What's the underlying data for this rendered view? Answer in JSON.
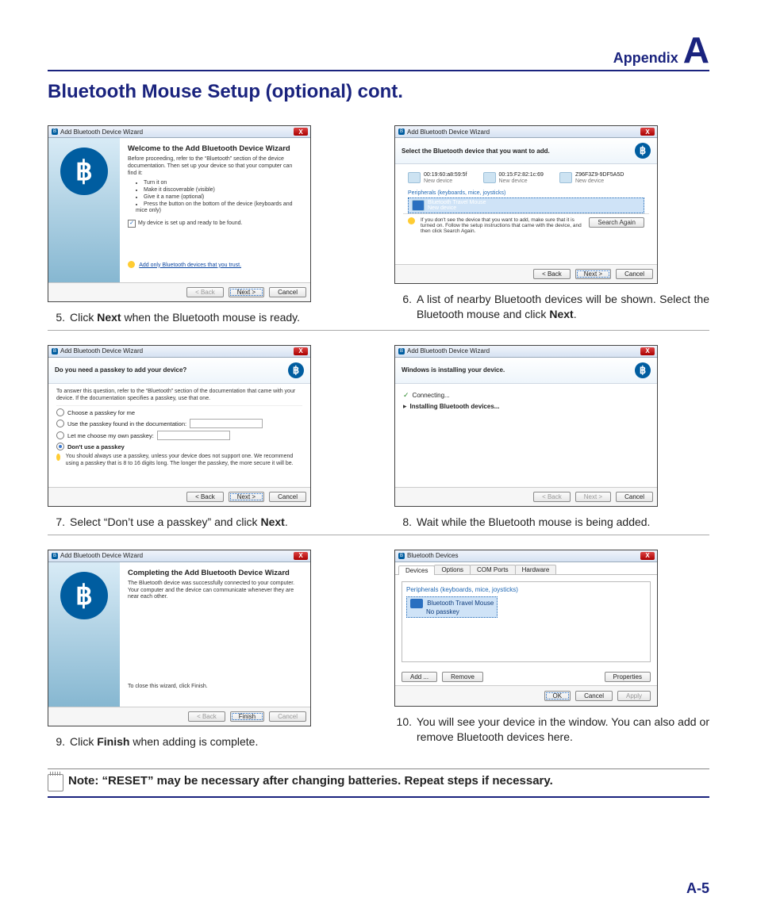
{
  "header": {
    "appendix": "Appendix",
    "letter": "A"
  },
  "title": "Bluetooth Mouse Setup (optional) cont.",
  "page_number": "A-5",
  "note_text": "Note: “RESET” may be necessary after changing batteries. Repeat steps if necessary.",
  "wizard_title": "Add Bluetooth Device Wizard",
  "close_x": "X",
  "buttons": {
    "back": "< Back",
    "next": "Next >",
    "cancel": "Cancel",
    "finish": "Finish",
    "search_again": "Search Again",
    "add": "Add ...",
    "remove": "Remove",
    "properties": "Properties",
    "ok": "OK",
    "apply": "Apply"
  },
  "step5": {
    "num": "5.",
    "caption_before": "Click ",
    "caption_bold": "Next",
    "caption_after": " when the Bluetooth mouse is ready.",
    "welcome_title": "Welcome to the Add Bluetooth Device Wizard",
    "intro": "Before proceeding, refer to the “Bluetooth” section of the device documentation. Then set up your device so that your computer can find it:",
    "bullets": [
      "Turn it on",
      "Make it discoverable (visible)",
      "Give it a name (optional)",
      "Press the button on the bottom of the device (keyboards and mice only)"
    ],
    "checkbox": "My device is set up and ready to be found.",
    "trust_link": "Add only Bluetooth devices that you trust."
  },
  "step6": {
    "num": "6.",
    "caption_before": "A list of nearby Bluetooth devices will be shown. Select the Bluetooth mouse and click ",
    "caption_bold": "Next",
    "caption_after": ".",
    "header": "Select the Bluetooth device that you want to add.",
    "devices": [
      {
        "name": "00:19:60:a8:59:5f",
        "sub": "New device"
      },
      {
        "name": "00:15:F2:82:1c:69",
        "sub": "New device"
      },
      {
        "name": "Z96F3Z9-9DF5A5D",
        "sub": "New device"
      }
    ],
    "category": "Peripherals (keyboards, mice, joysticks)",
    "selected": {
      "name": "Bluetooth Travel Mouse",
      "sub": "New device"
    },
    "hint": "If you don't see the device that you want to add, make sure that it is turned on. Follow the setup instructions that came with the device, and then click Search Again."
  },
  "step7": {
    "num": "7.",
    "caption_before": "Select “Don’t use a passkey” and click ",
    "caption_bold": "Next",
    "caption_after": ".",
    "header": "Do you need a passkey to add your device?",
    "intro": "To answer this question, refer to the “Bluetooth” section of the documentation that came with your device. If the documentation specifies a passkey, use that one.",
    "opt1": "Choose a passkey for me",
    "opt2": "Use the passkey found in the documentation:",
    "opt3": "Let me choose my own passkey:",
    "opt4": "Don't use a passkey",
    "tip": "You should always use a passkey, unless your device does not support one. We recommend using a passkey that is 8 to 16 digits long. The longer the passkey, the more secure it will be."
  },
  "step8": {
    "num": "8.",
    "caption": "Wait while the Bluetooth mouse is being added.",
    "header": "Windows is installing your device.",
    "items": [
      "Connecting...",
      "Installing Bluetooth devices..."
    ]
  },
  "step9": {
    "num": "9.",
    "caption_before": "Click ",
    "caption_bold": "Finish",
    "caption_after": " when adding is complete.",
    "title2": "Completing the Add Bluetooth Device Wizard",
    "msg": "The Bluetooth device was successfully connected to your computer. Your computer and the device can communicate whenever they are near each other.",
    "close_msg": "To close this wizard, click Finish."
  },
  "step10": {
    "num": "10.",
    "caption": "You will see your device in the window. You can also add or remove Bluetooth devices here.",
    "title": "Bluetooth Devices",
    "tabs": [
      "Devices",
      "Options",
      "COM Ports",
      "Hardware"
    ],
    "category": "Peripherals (keyboards, mice, joysticks)",
    "item_name": "Bluetooth Travel Mouse",
    "item_sub": "No passkey"
  }
}
